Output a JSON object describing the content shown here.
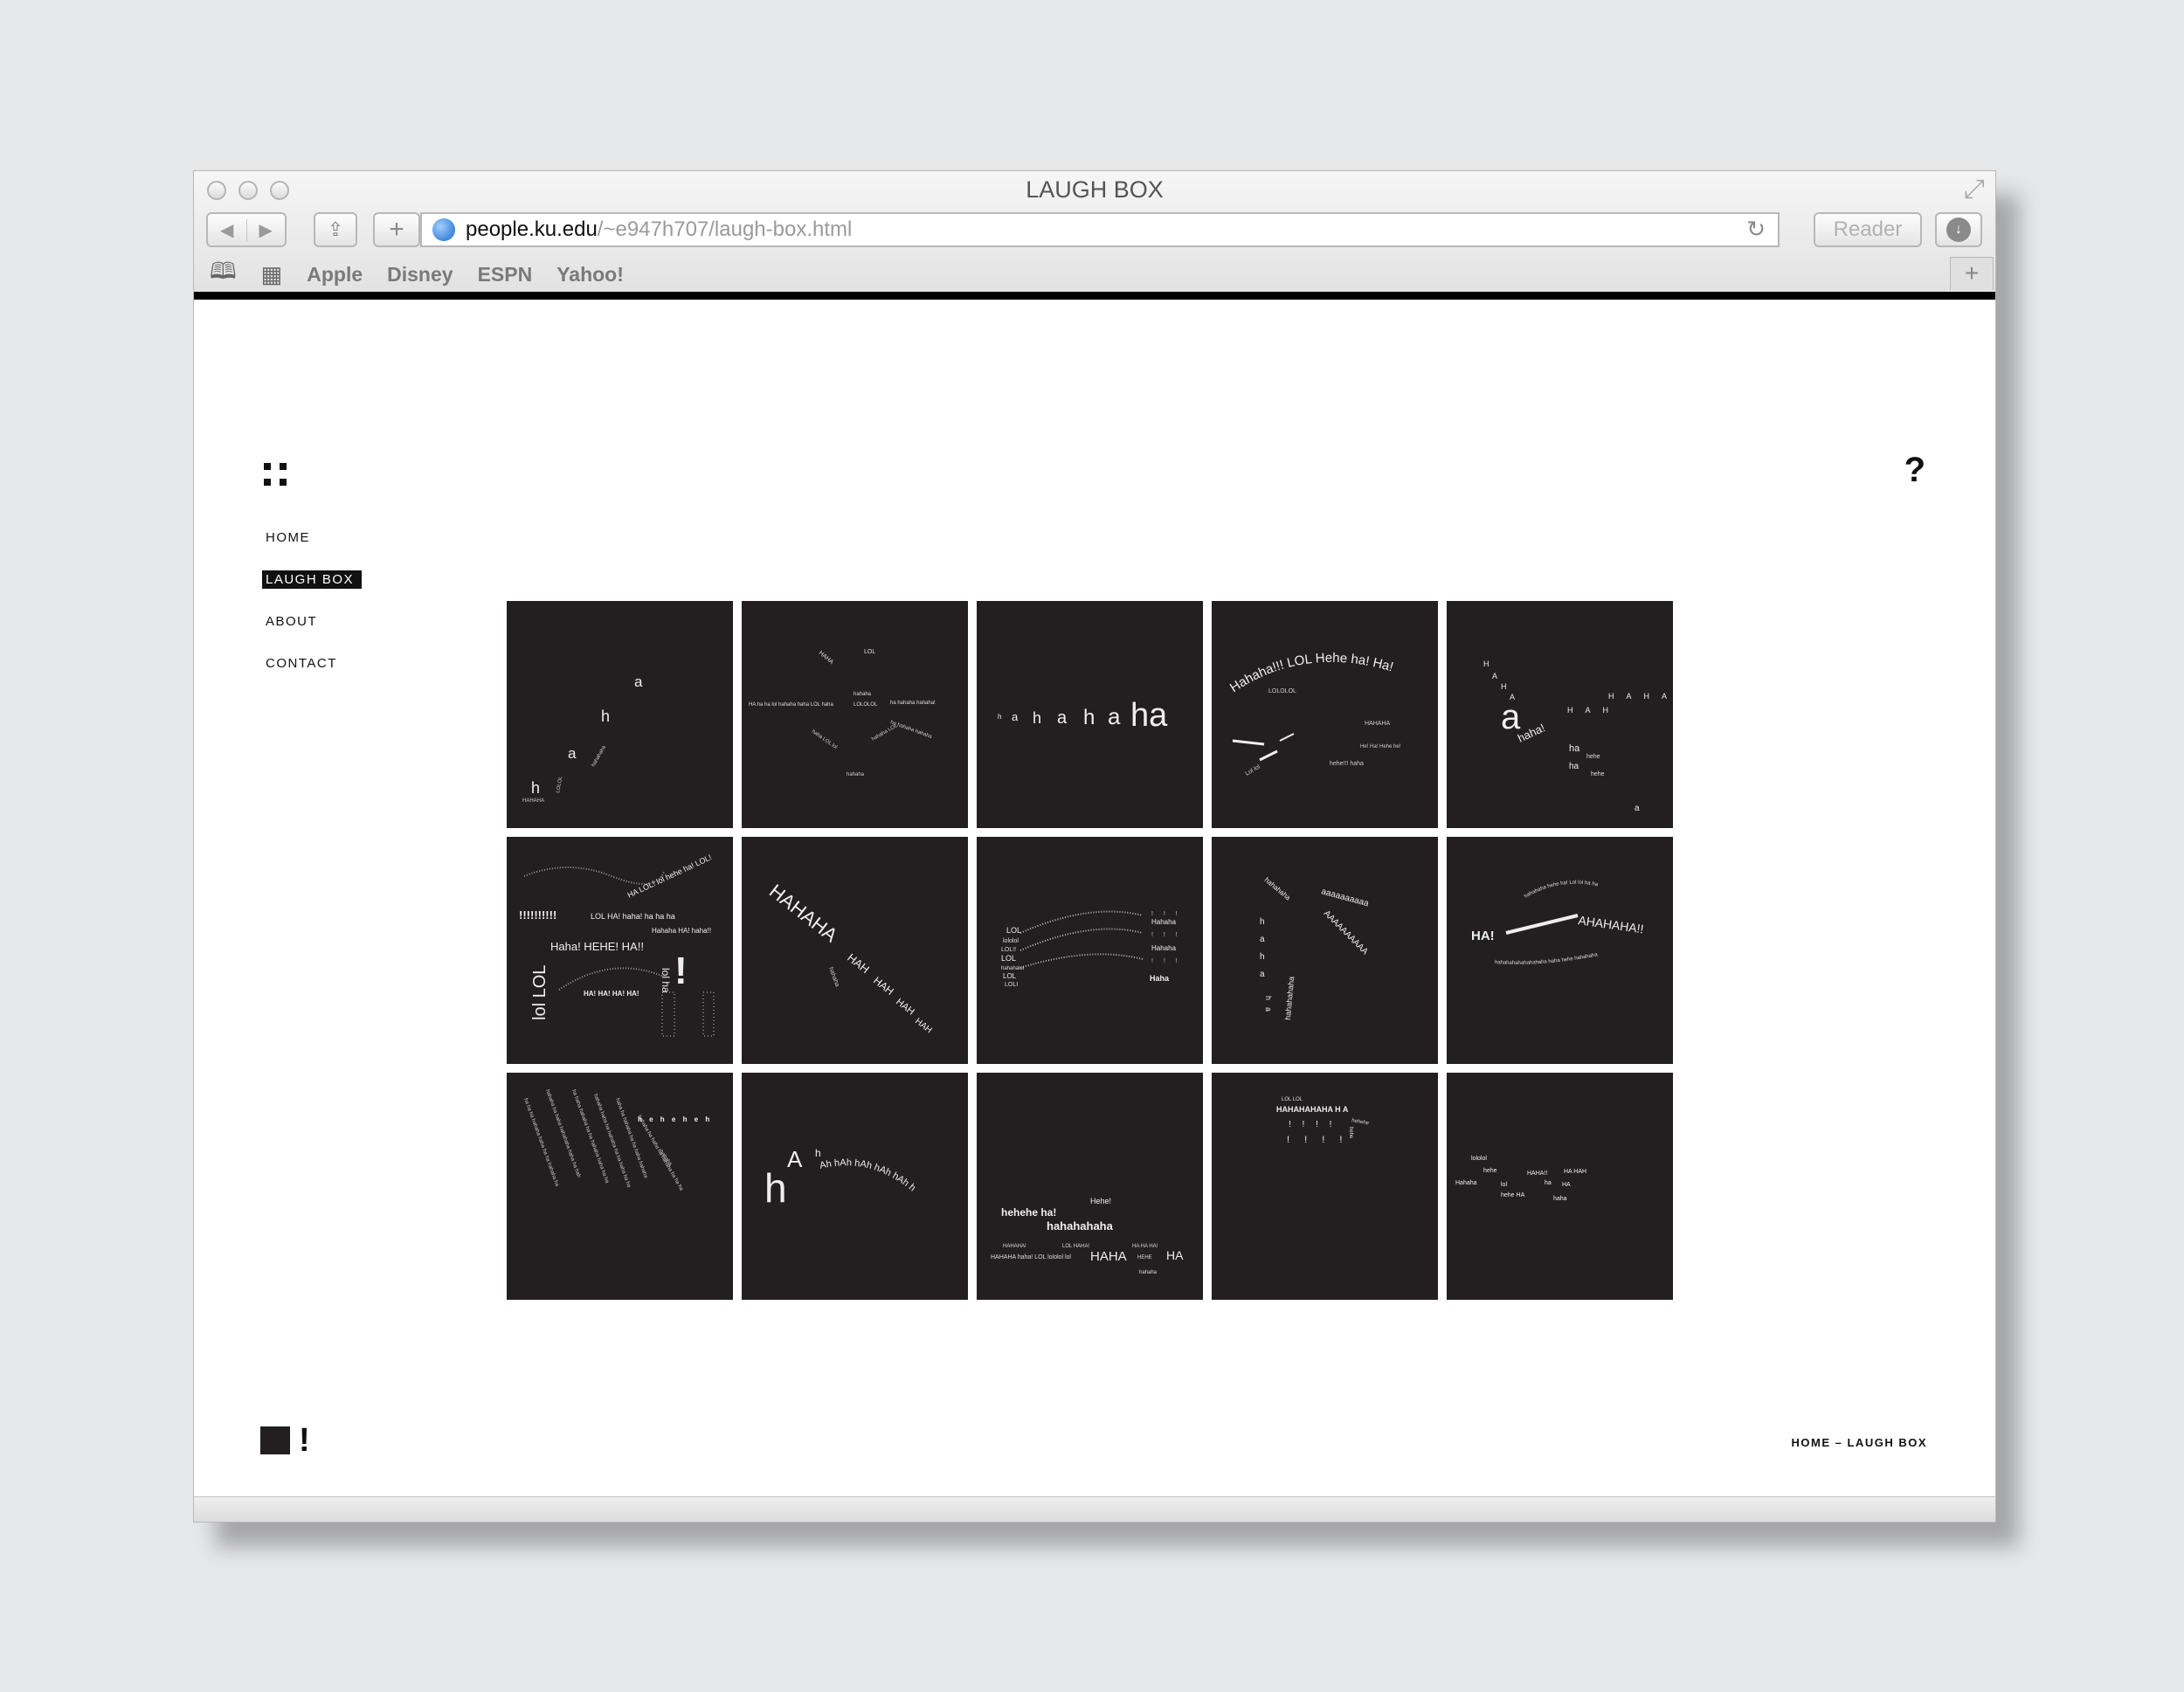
{
  "window": {
    "title": "LAUGH BOX",
    "url_host": "people.ku.edu",
    "url_path": "/~e947h707/laugh-box.html",
    "reader_label": "Reader"
  },
  "bookmarks": [
    "Apple",
    "Disney",
    "ESPN",
    "Yahoo!"
  ],
  "page": {
    "help_label": "?",
    "nav": [
      {
        "label": "HOME",
        "active": false
      },
      {
        "label": "LAUGH BOX",
        "active": true
      },
      {
        "label": "ABOUT",
        "active": false
      },
      {
        "label": "CONTACT",
        "active": false
      }
    ],
    "footer_mark": "!",
    "breadcrumb": "HOME –  LAUGH BOX"
  },
  "tiles": [
    {
      "words": [
        "a",
        "h",
        "a",
        "h",
        "HAHAHA",
        "LOLOL",
        "hahahaha"
      ]
    },
    {
      "words": [
        "HAHA",
        "LOL",
        "hahaha",
        "LOLOLOL",
        "ha hahaha hahaha!",
        "HA ha ha lol hahaha haha LOL haha"
      ]
    },
    {
      "words": [
        "h",
        "a",
        "h",
        "a",
        "h",
        "a",
        "ha"
      ]
    },
    {
      "words": [
        "Hahaha!!! LOL Hehe ha! Ha!",
        "LOLOLOL",
        "HAHAHA",
        "He! Ha! Hehe he!",
        "hehe!!! haha",
        "Lol lol"
      ]
    },
    {
      "words": [
        "H",
        "A",
        "H",
        "A",
        "H",
        "a",
        "haha!",
        "H A H",
        "H A H A H",
        "ha",
        "hehe",
        "ha",
        "hehe",
        "a"
      ]
    },
    {
      "words": [
        "!!!!!!!!!!",
        "LOL HA! haha! ha ha ha",
        "HA LOL! lol hehe ha! LOL!",
        "Hahaha HA! haha!!",
        "Haha! HEHE! HA!!",
        "lol LOL",
        "HA! HA! HA! HA!",
        "lol ha",
        "!"
      ]
    },
    {
      "words": [
        "HAHAHA",
        "HAH",
        "HAH",
        "HAH",
        "HAH",
        "hahaha"
      ]
    },
    {
      "words": [
        "LOL",
        "lololol",
        "LOL!!",
        "LOL",
        "hahahalol",
        "LOL",
        "LOLI",
        "Hahaha",
        "Hahaha",
        "Haha"
      ]
    },
    {
      "words": [
        "hahahaha",
        "aaaaaaaaaa",
        "AAAAAAAAAA",
        "h",
        "a",
        "h",
        "a",
        "hahahahaha"
      ]
    },
    {
      "words": [
        "HA!",
        "AHAHAHA!!",
        "hahahaha hehe ha! Lol lol ha ha",
        "hahahahahahahahaha haha hehe hahahaha"
      ]
    },
    {
      "words": [
        "hahaha",
        "h e h e h e h"
      ]
    },
    {
      "words": [
        "h",
        "A",
        "h",
        "Ah hAh hAh hAh hAh h"
      ]
    },
    {
      "words": [
        "Hehe!",
        "hehehe ha!",
        "hahahahaha",
        "HAHAHA!",
        "LOL HAHA!",
        "HA HA HA!",
        "HAHAHA haha! LOL lololol lol",
        "HAHA",
        "HEHE",
        "HA",
        "hahaha"
      ]
    },
    {
      "words": [
        "LOL LOL",
        "HAHAHAHAHA H A",
        "hehehe",
        "! ! ! !",
        "! ! ! !",
        "hehe"
      ]
    },
    {
      "words": [
        "lololol",
        "hehe",
        "Hahaha",
        "lol",
        "hehe HA",
        "HAHA!!",
        "ha",
        "HA",
        "haha",
        "HA HAH"
      ]
    }
  ]
}
